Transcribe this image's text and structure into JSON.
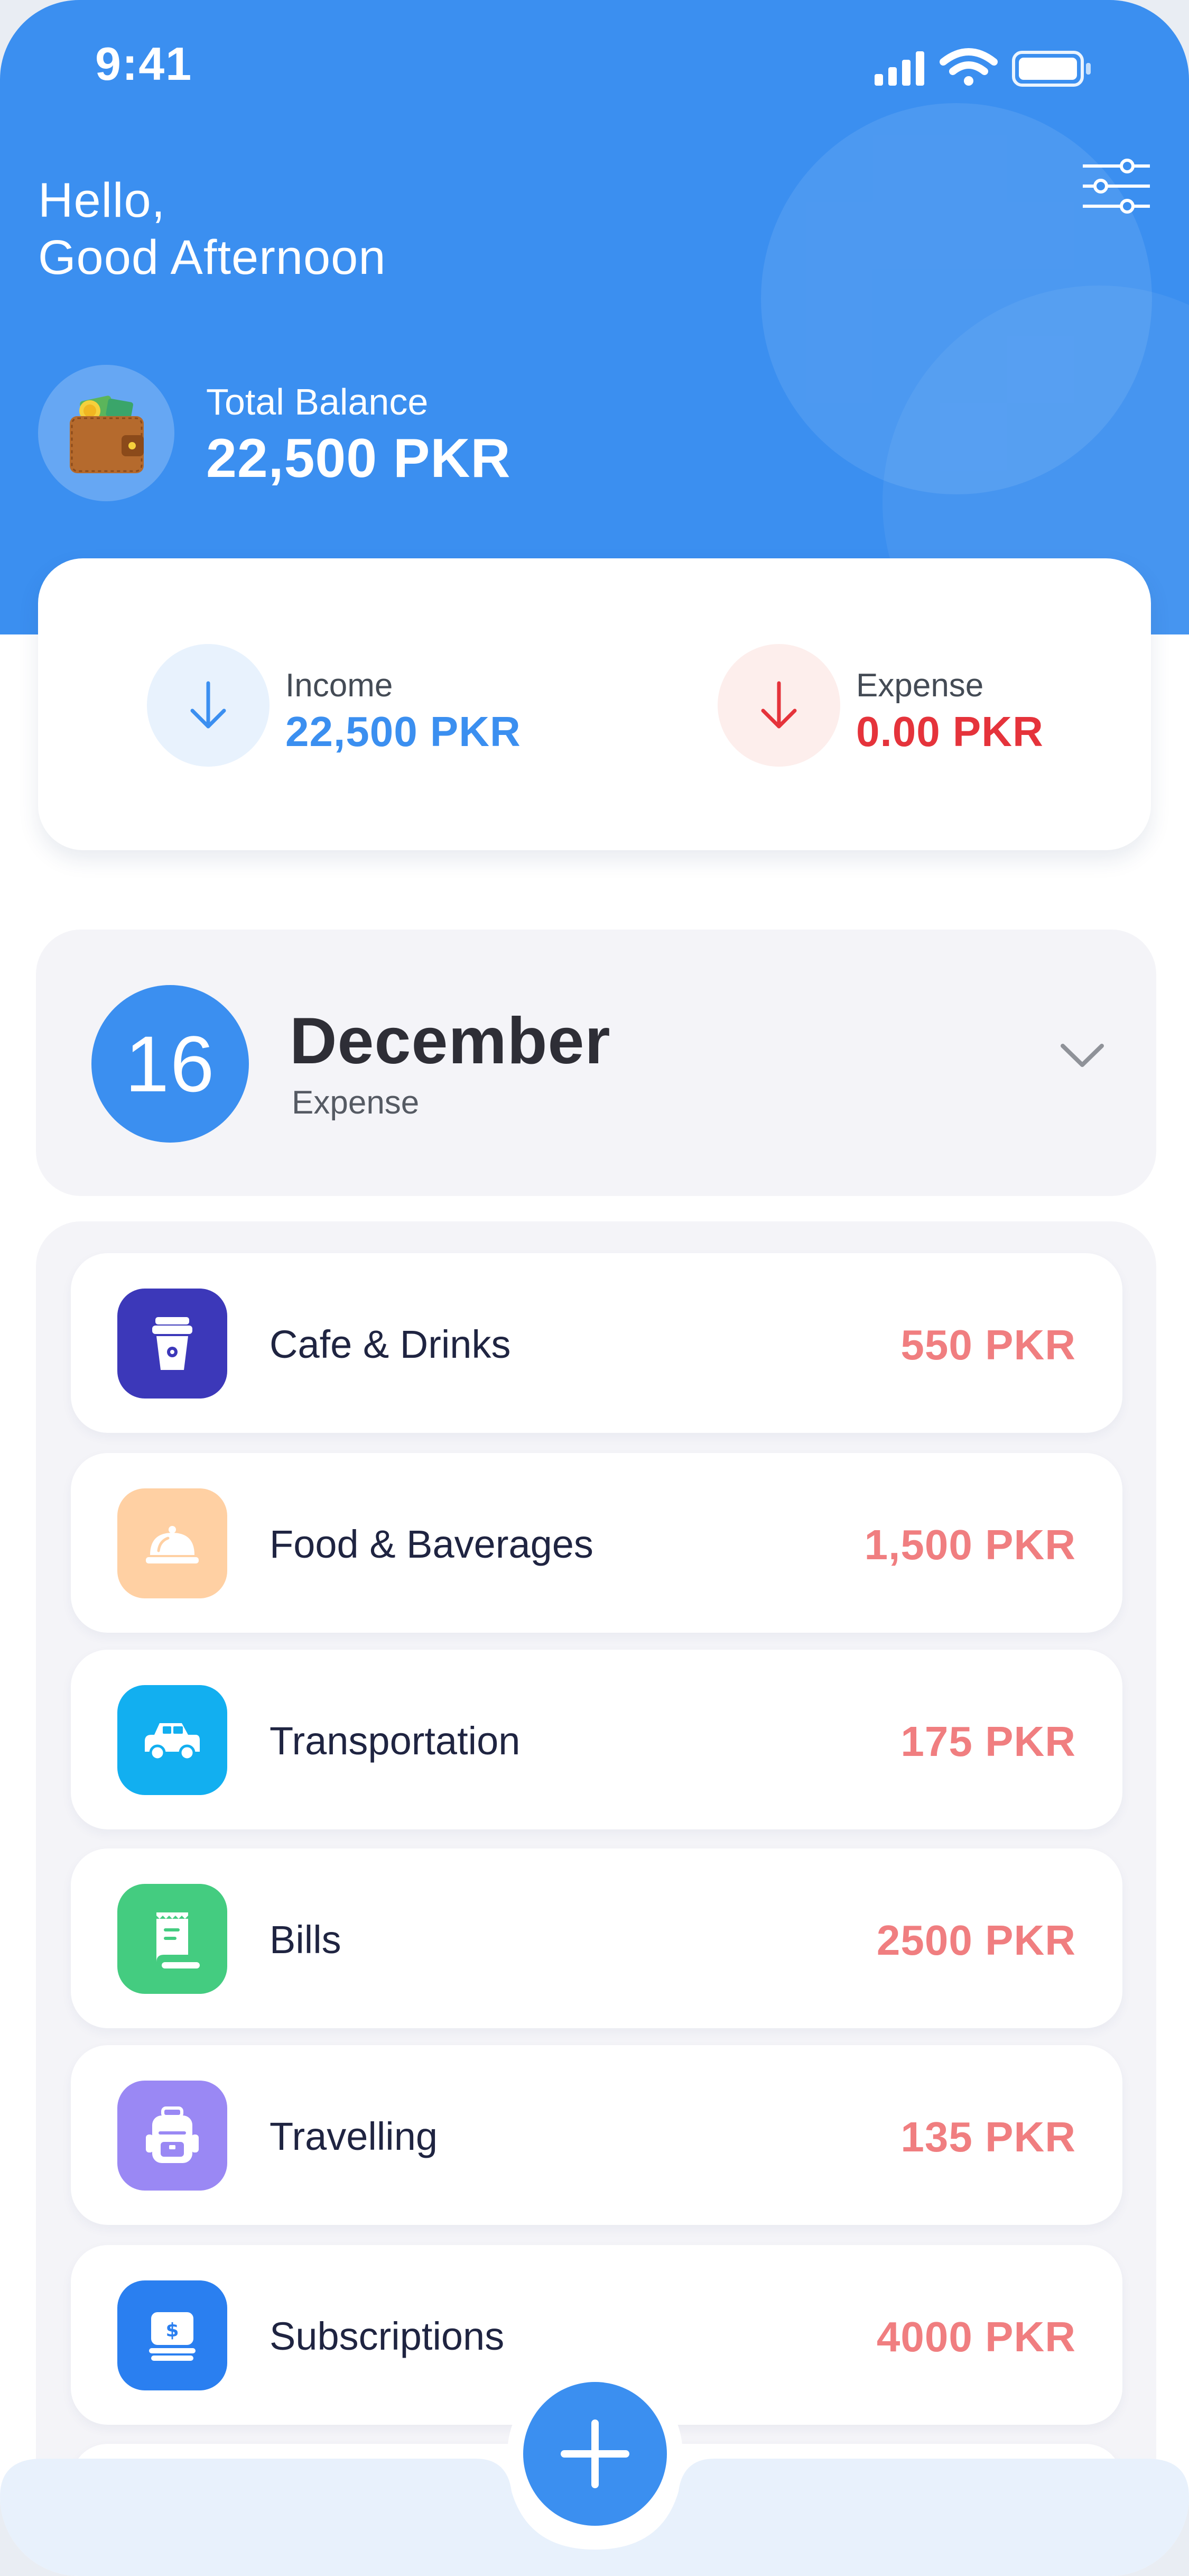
{
  "status_bar": {
    "time": "9:41"
  },
  "header": {
    "greeting_line1": "Hello,",
    "greeting_line2": "Good Afternoon",
    "balance_label": "Total Balance",
    "balance_value": "22,500 PKR",
    "filter_icon": "sliders-icon",
    "wallet_icon": "wallet-icon"
  },
  "summary": {
    "income_label": "Income",
    "income_value": "22,500 PKR",
    "expense_label": "Expense",
    "expense_value": "0.00 PKR"
  },
  "date_card": {
    "day": "16",
    "month": "December",
    "subtitle": "Expense"
  },
  "expenses": [
    {
      "name": "Cafe & Drinks",
      "amount": "550 PKR",
      "icon": "coffee-cup-icon",
      "color": "#3c38b9"
    },
    {
      "name": "Food & Baverages",
      "amount": "1,500 PKR",
      "icon": "food-cloche-icon",
      "color": "#ffd0a3"
    },
    {
      "name": "Transportation",
      "amount": "175 PKR",
      "icon": "car-icon",
      "color": "#12aff0"
    },
    {
      "name": "Bills",
      "amount": "2500 PKR",
      "icon": "receipt-icon",
      "color": "#44cc80"
    },
    {
      "name": "Travelling",
      "amount": "135 PKR",
      "icon": "backpack-icon",
      "color": "#9a88f4"
    },
    {
      "name": "Subscriptions",
      "amount": "4000 PKR",
      "icon": "money-stack-icon",
      "color": "#2a7ff0"
    }
  ],
  "colors": {
    "primary": "#3b8ff0",
    "income": "#3b8ff0",
    "expense": "#e5333b",
    "amount": "#f07e80"
  },
  "fab": {
    "icon": "plus-icon"
  }
}
